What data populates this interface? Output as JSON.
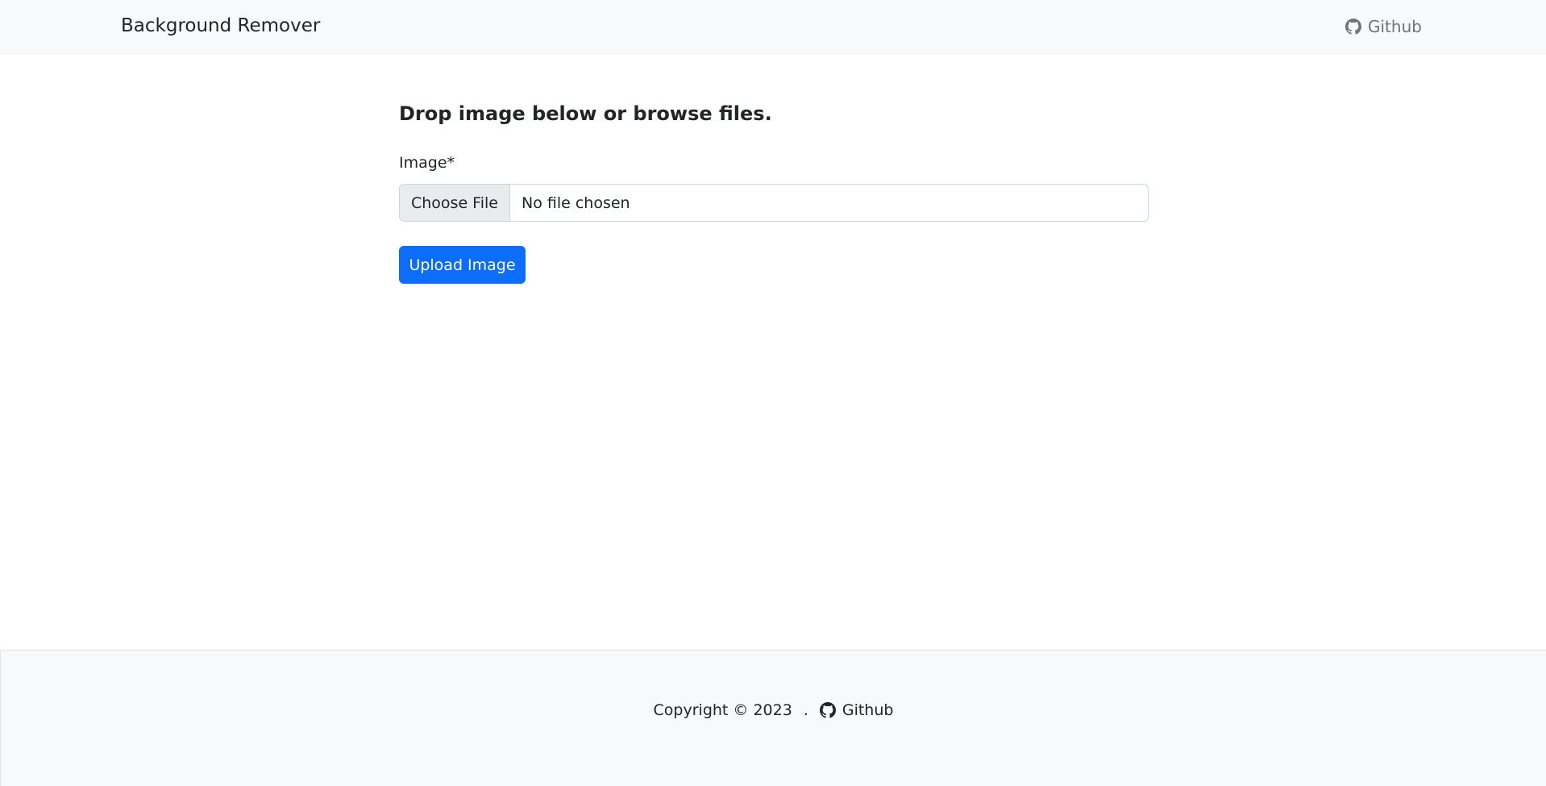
{
  "navbar": {
    "brand": "Background Remover",
    "github_label": "Github",
    "github_icon": "github-icon"
  },
  "main": {
    "heading": "Drop image below or browse files.",
    "image_label": "Image*",
    "file_input": {
      "button_label": "Choose File",
      "status": "No file chosen"
    },
    "upload_button": "Upload Image"
  },
  "footer": {
    "copyright": "Copyright © 2023",
    "separator": ".",
    "github_label": "Github",
    "github_icon": "github-icon"
  },
  "colors": {
    "primary": "#0d6efd",
    "navbar_bg": "#f8f9fa",
    "muted_text": "#6c757d",
    "text": "#212529"
  }
}
